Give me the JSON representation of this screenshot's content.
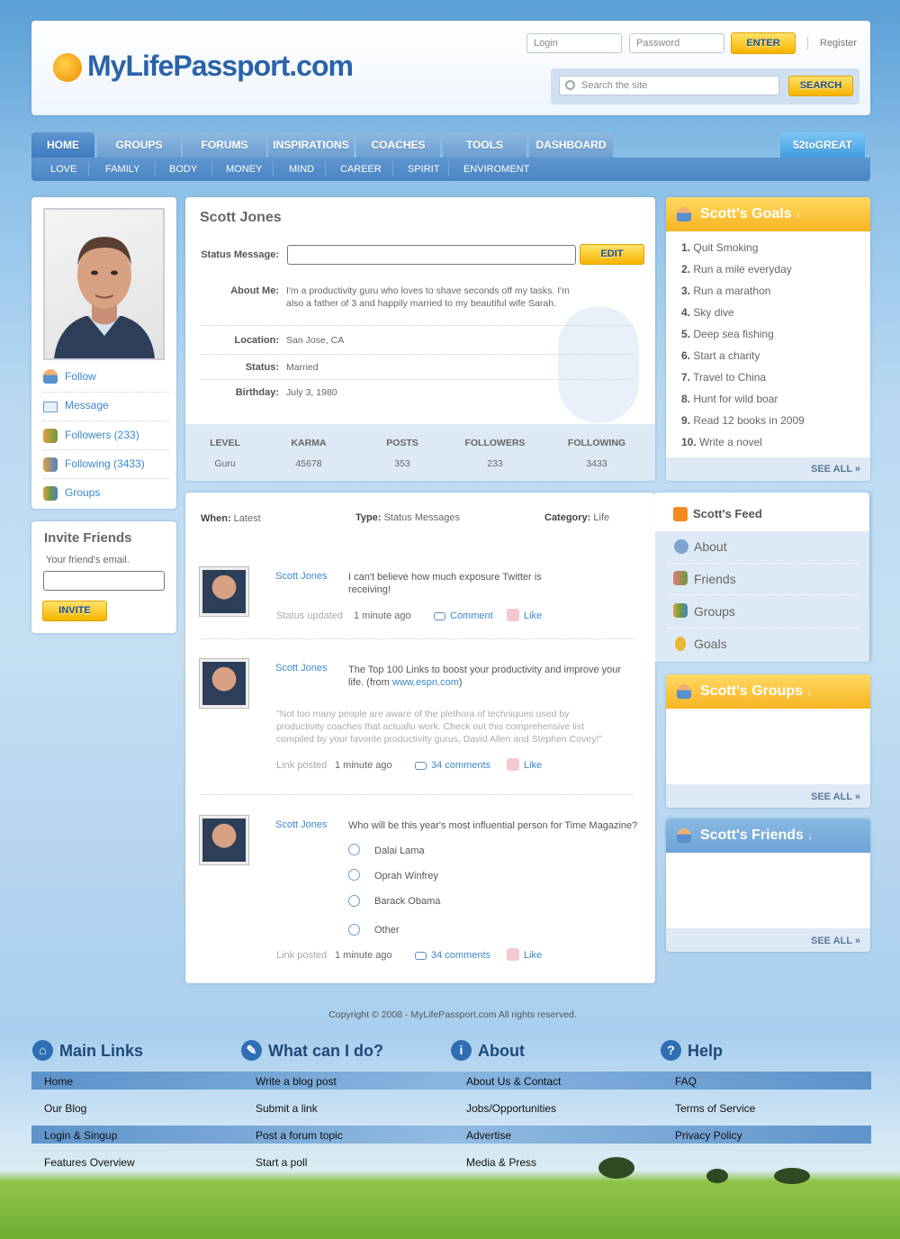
{
  "header": {
    "logo": "MyLifePassport.com",
    "login_placeholder": "Login",
    "password_placeholder": "Password",
    "enter_label": "ENTER",
    "register_label": "Register",
    "search_placeholder": "Search the site",
    "search_label": "SEARCH"
  },
  "nav": {
    "tabs": [
      "HOME",
      "GROUPS",
      "FORUMS",
      "INSPIRATIONS",
      "COACHES",
      "TOOLS",
      "DASHBOARD"
    ],
    "special": "52toGREAT",
    "sub": [
      "LOVE",
      "FAMILY",
      "BODY",
      "MONEY",
      "MIND",
      "CAREER",
      "SPIRIT",
      "ENVIROMENT"
    ]
  },
  "sidebar": {
    "actions": [
      "Follow",
      "Message",
      "Followers (233)",
      "Following (3433)",
      "Groups"
    ],
    "invite_title": "Invite Friends",
    "invite_hint": "Your friend's email.",
    "invite_label": "INVITE"
  },
  "profile": {
    "name": "Scott Jones",
    "status_label": "Status Message:",
    "edit_label": "EDIT",
    "about_label": "About Me:",
    "about_line1": "I'm a productivity guru who loves to shave seconds off my tasks. I'm",
    "about_line2": "also a father of 3 and happily married to my beautiful wife Sarah.",
    "location_label": "Location:",
    "location": "San Jose, CA",
    "status_field_label": "Status:",
    "status": "Married",
    "birthday_label": "Birthday:",
    "birthday": "July 3, 1980",
    "stats": [
      {
        "label": "LEVEL",
        "value": "Guru"
      },
      {
        "label": "KARMA",
        "value": "45678"
      },
      {
        "label": "POSTS",
        "value": "353"
      },
      {
        "label": "FOLLOWERS",
        "value": "233"
      },
      {
        "label": "FOLLOWING",
        "value": "3433"
      }
    ]
  },
  "filters": {
    "when_label": "When:",
    "when": "Latest",
    "type_label": "Type:",
    "type": "Status Messages",
    "category_label": "Category:",
    "category": "Life"
  },
  "posts": [
    {
      "author": "Scott Jones",
      "line1": "I can't believe how much exposure Twitter is",
      "line2": "receiving!",
      "meta": "Status updated",
      "time": "1 minute ago",
      "comment": "Comment",
      "like": "Like"
    },
    {
      "author": "Scott Jones",
      "line1": "The Top 100 Links to boost your productivity and improve your",
      "line2": "life. (from ",
      "link": "www.espn.com",
      "line2_end": ")",
      "quote1": "\"Not too many people are aware of the plethora of techniques used by",
      "quote2": "productivity coaches that actuallu work. Check out this comprehensive list",
      "quote3": "compiled by your favorite productivity gurus, David Allen and Stephen Covey!\"",
      "meta": "Link posted",
      "time": "1 minute ago",
      "comment": "34 comments",
      "like": "Like"
    },
    {
      "author": "Scott Jones",
      "line1": "Who will be this year's most influential person for Time Magazine?",
      "options": [
        "Dalai Lama",
        "Oprah Winfrey",
        "Barack Obama",
        "Other"
      ],
      "meta": "Link posted",
      "time": "1 minute ago",
      "comment": "34 comments",
      "like": "Like"
    }
  ],
  "goals": {
    "title": "Scott's Goals",
    "items": [
      "Quit Smoking",
      "Run a mile everyday",
      "Run a marathon",
      "Sky dive",
      "Deep sea fishing",
      "Start a charity",
      "Travel to China",
      "Hunt for wild boar",
      "Read 12 books in 2009",
      "Write a novel"
    ],
    "see_all": "SEE ALL »"
  },
  "feed": {
    "title": "Scott's Feed",
    "items": [
      "About",
      "Friends",
      "Groups",
      "Goals"
    ]
  },
  "groups_box": {
    "title": "Scott's Groups",
    "see_all": "SEE ALL »"
  },
  "friends_box": {
    "title": "Scott's Friends",
    "see_all": "SEE ALL »"
  },
  "footer": {
    "copyright": "Copyright ©  2008 - MyLifePassport.com All rights reserved.",
    "columns": [
      {
        "title": "Main Links",
        "links": [
          "Home",
          "Our Blog",
          "Login & Singup",
          "Features Overview"
        ]
      },
      {
        "title": "What can I do?",
        "links": [
          "Write a blog post",
          "Submit a link",
          "Post a forum topic",
          "Start a poll"
        ]
      },
      {
        "title": "About",
        "links": [
          "About Us & Contact",
          "Jobs/Opportunities",
          "Advertise",
          "Media & Press"
        ]
      },
      {
        "title": "Help",
        "links": [
          "FAQ",
          "Terms of Service",
          "Privacy Policy"
        ]
      }
    ]
  }
}
